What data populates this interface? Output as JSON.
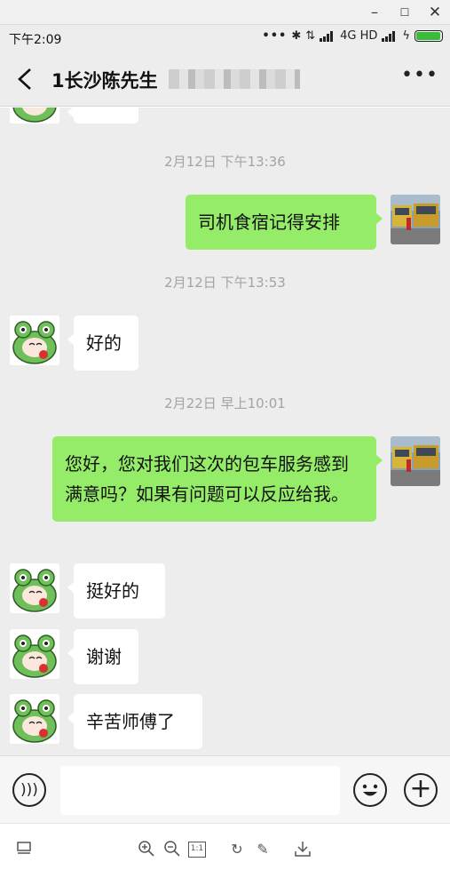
{
  "statusbar": {
    "time": "下午2:09",
    "network": "4G HD",
    "battery_level": 0.9
  },
  "header": {
    "title": "1长沙陈先生"
  },
  "chat": {
    "timestamps": [
      "2月12日 下午13:36",
      "2月12日 下午13:53",
      "2月22日 早上10:01"
    ],
    "messages": [
      {
        "from": "me",
        "text": "司机食宿记得安排"
      },
      {
        "from": "them",
        "text": "好的"
      },
      {
        "from": "me",
        "text": "您好，您对我们这次的包车服务感到满意吗？如果有问题可以反应给我。"
      },
      {
        "from": "them",
        "text": "挺好的"
      },
      {
        "from": "them",
        "text": "谢谢"
      },
      {
        "from": "them",
        "text": "辛苦师傅了"
      }
    ]
  },
  "input": {
    "value": "",
    "placeholder": ""
  },
  "colors": {
    "sent_bubble": "#95ec69",
    "received_bubble": "#ffffff",
    "chat_bg": "#ededed",
    "timestamp_text": "#a3a3a3"
  },
  "icons": {
    "back": "chevron-left-icon",
    "more": "more-dots-icon",
    "voice": "voice-icon",
    "emoji": "emoji-icon",
    "plus": "plus-icon",
    "viewer_tools": [
      "monitor-icon",
      "zoom-in-icon",
      "zoom-out-icon",
      "actual-size-icon",
      "rotate-icon",
      "edit-icon",
      "download-icon"
    ]
  }
}
